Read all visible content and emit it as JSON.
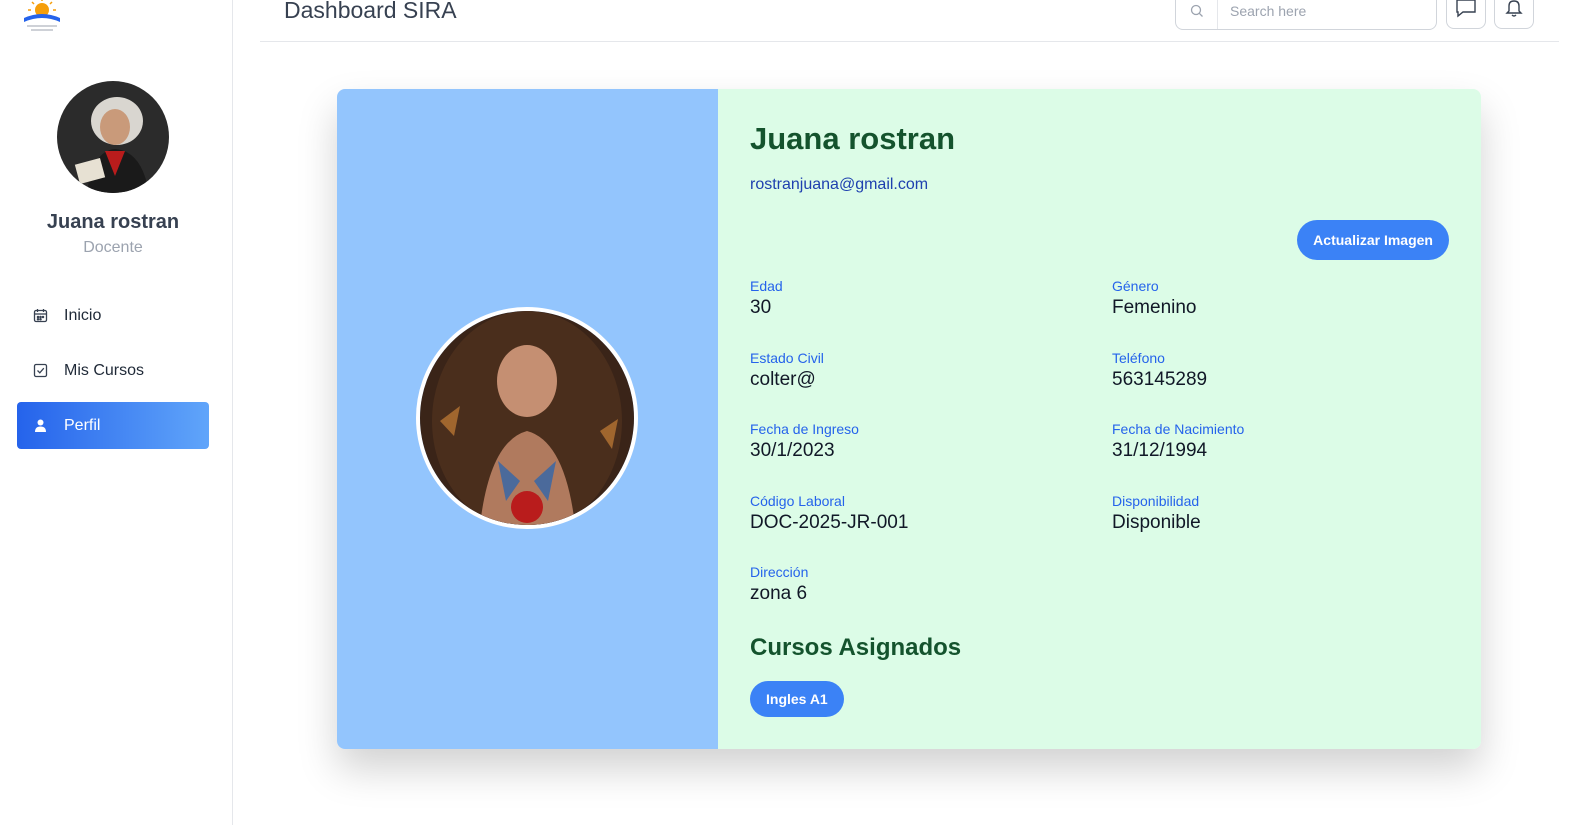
{
  "header": {
    "title": "Dashboard SIRA",
    "search_placeholder": "Search here",
    "messages_icon": "message-icon",
    "notifications_icon": "bell-icon"
  },
  "sidebar": {
    "user_name": "Juana rostran",
    "user_role": "Docente",
    "items": [
      {
        "label": "Inicio",
        "icon": "calendar-icon",
        "active": false
      },
      {
        "label": "Mis Cursos",
        "icon": "checkbox-icon",
        "active": false
      },
      {
        "label": "Perfil",
        "icon": "user-icon",
        "active": true
      }
    ]
  },
  "profile": {
    "name": "Juana rostran",
    "email": "rostranjuana@gmail.com",
    "update_button": "Actualizar Imagen",
    "fields": {
      "edad": {
        "label": "Edad",
        "value": "30"
      },
      "genero": {
        "label": "Género",
        "value": "Femenino"
      },
      "estado_civil": {
        "label": "Estado Civil",
        "value": "colter@"
      },
      "telefono": {
        "label": "Teléfono",
        "value": "563145289"
      },
      "fecha_ingreso": {
        "label": "Fecha de Ingreso",
        "value": "30/1/2023"
      },
      "fecha_nacimiento": {
        "label": "Fecha de Nacimiento",
        "value": "31/12/1994"
      },
      "codigo": {
        "label": "Código Laboral",
        "value": "DOC-2025-JR-001"
      },
      "disponibilidad": {
        "label": "Disponibilidad",
        "value": "Disponible"
      },
      "direccion": {
        "label": "Dirección",
        "value": "zona 6"
      }
    },
    "courses_title": "Cursos Asignados",
    "courses": [
      "Ingles A1"
    ]
  },
  "colors": {
    "accent": "#3b82f6",
    "card_left_bg": "#93c5fd",
    "card_right_bg": "#dcfce7",
    "heading_green": "#14532d"
  }
}
